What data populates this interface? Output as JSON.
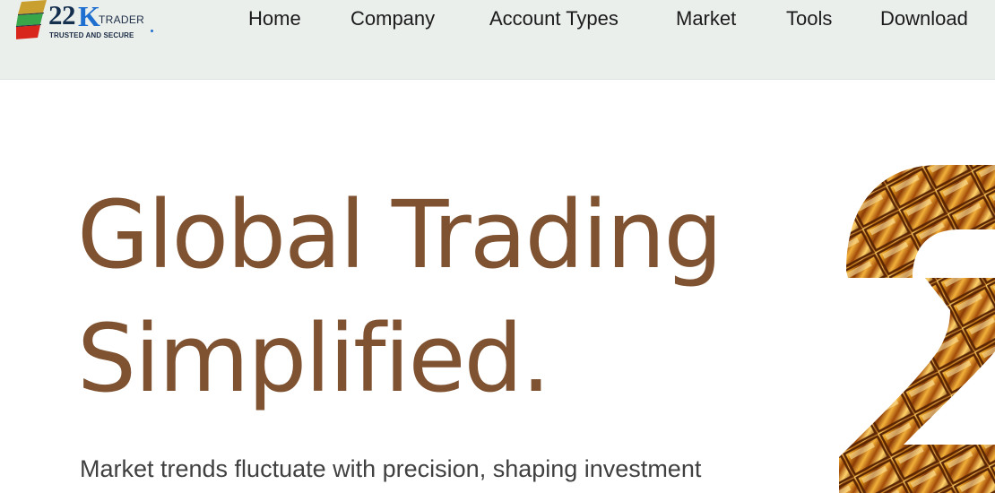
{
  "brand": {
    "number": "22",
    "letter": "K",
    "word": "TRADER",
    "tagline": "TRUSTED AND SECURE",
    "colors": {
      "navy": "#15304f",
      "blue": "#1f6fd0",
      "red": "#d9261c",
      "green": "#3aa64a",
      "gold": "#c9a030"
    }
  },
  "nav": {
    "items": [
      {
        "label": "Home"
      },
      {
        "label": "Company"
      },
      {
        "label": "Account Types"
      },
      {
        "label": "Market"
      },
      {
        "label": "Tools"
      },
      {
        "label": "Download"
      }
    ]
  },
  "hero": {
    "title_line1": "Global Trading",
    "title_line2": "Simplified.",
    "subtitle": "Market trends fluctuate with precision, shaping investment",
    "title_color": "#7f5231",
    "art": "gold-bars-22-graphic"
  }
}
